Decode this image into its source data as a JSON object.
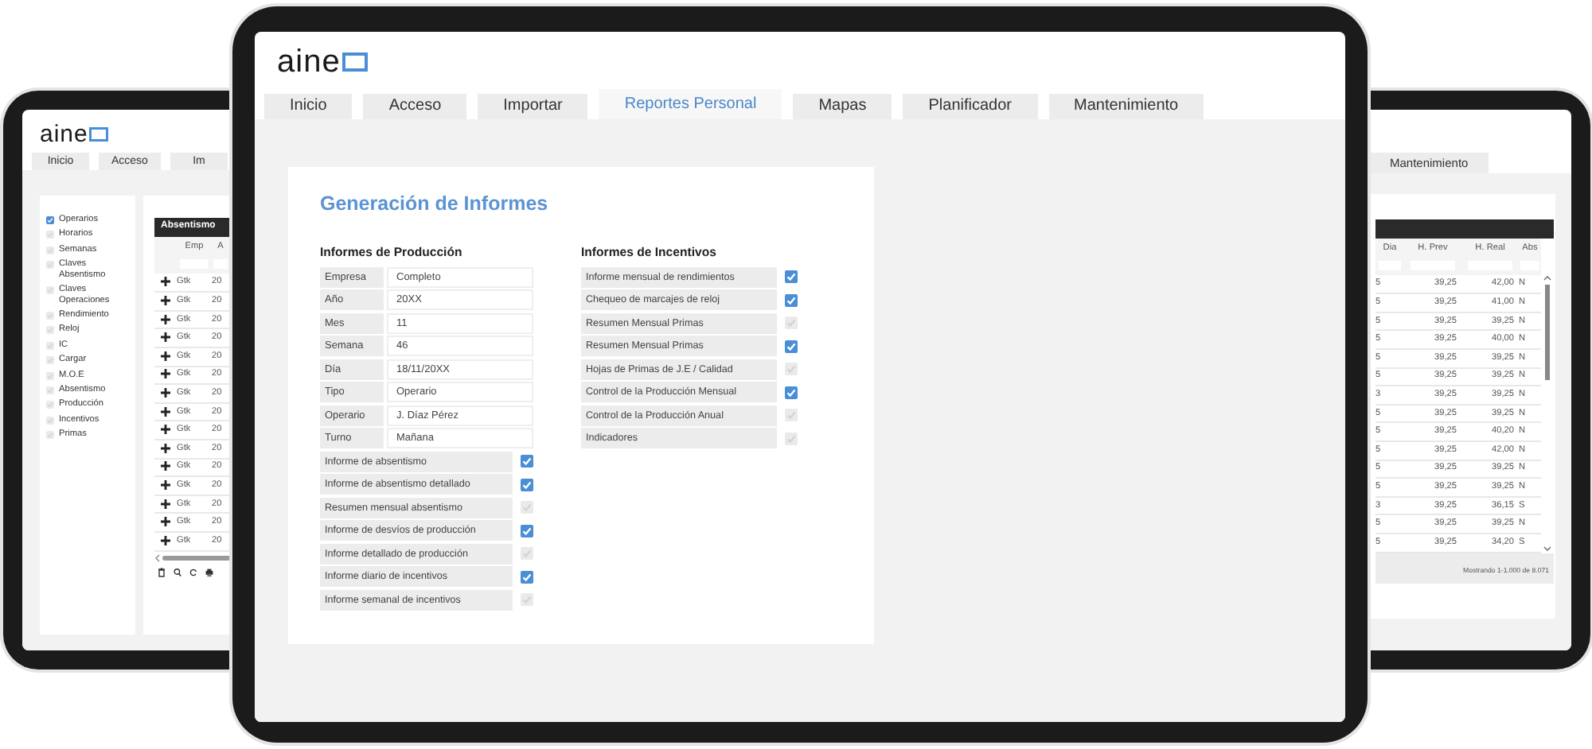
{
  "left_tablet": {
    "logo": "aine",
    "tabs": [
      {
        "label": "Inicio",
        "selected": false
      },
      {
        "label": "Acceso",
        "selected": false
      },
      {
        "label": "Im",
        "selected": false
      }
    ],
    "sidebar": {
      "items": [
        {
          "label": "Operarios",
          "checked": true
        },
        {
          "label": "Horarios",
          "checked": false
        },
        {
          "label": "Semanas",
          "checked": false
        },
        {
          "label": "Claves Absentismo",
          "checked": false
        },
        {
          "label": "Claves Operaciones",
          "checked": false
        },
        {
          "label": "Rendimiento",
          "checked": false
        },
        {
          "label": "Reloj",
          "checked": false
        },
        {
          "label": "IC",
          "checked": false
        },
        {
          "label": "Cargar",
          "checked": false
        },
        {
          "label": "M.O.E",
          "checked": false
        },
        {
          "label": "Absentismo",
          "checked": false
        },
        {
          "label": "Producción",
          "checked": false
        },
        {
          "label": "Incentivos",
          "checked": false
        },
        {
          "label": "Primas",
          "checked": false
        }
      ]
    },
    "table": {
      "title": "Absentismo",
      "columns": [
        "Emp",
        "A"
      ],
      "rows": [
        [
          "Gtk",
          "20"
        ],
        [
          "Gtk",
          "20"
        ],
        [
          "Gtk",
          "20"
        ],
        [
          "Gtk",
          "20"
        ],
        [
          "Gtk",
          "20"
        ],
        [
          "Gtk",
          "20"
        ],
        [
          "Gtk",
          "20"
        ],
        [
          "Gtk",
          "20"
        ],
        [
          "Gtk",
          "20"
        ],
        [
          "Gtk",
          "20"
        ],
        [
          "Gtk",
          "20"
        ],
        [
          "Gtk",
          "20"
        ],
        [
          "Gtk",
          "20"
        ],
        [
          "Gtk",
          "20"
        ],
        [
          "Gtk",
          "20"
        ]
      ]
    }
  },
  "main_tablet": {
    "logo": "aine",
    "tabs": [
      {
        "label": "Inicio",
        "selected": false
      },
      {
        "label": "Acceso",
        "selected": false
      },
      {
        "label": "Importar",
        "selected": false
      },
      {
        "label": "Reportes Personal",
        "selected": true
      },
      {
        "label": "Mapas",
        "selected": false
      },
      {
        "label": "Planificador",
        "selected": false
      },
      {
        "label": "Mantenimiento",
        "selected": false
      }
    ],
    "panel": {
      "title": "Generación de Informes",
      "production": {
        "heading": "Informes de Producción",
        "fields": [
          {
            "label": "Empresa",
            "value": "Completo"
          },
          {
            "label": "Año",
            "value": "20XX"
          },
          {
            "label": "Mes",
            "value": "11"
          },
          {
            "label": "Semana",
            "value": "46"
          },
          {
            "label": "Día",
            "value": "18/11/20XX"
          },
          {
            "label": "Tipo",
            "value": "Operario"
          },
          {
            "label": "Operario",
            "value": "J. Díaz Pérez"
          },
          {
            "label": "Turno",
            "value": "Mañana"
          }
        ],
        "reports": [
          {
            "label": "Informe de absentismo",
            "checked": true
          },
          {
            "label": "Informe de absentismo detallado",
            "checked": true
          },
          {
            "label": "Resumen mensual absentismo",
            "checked": false
          },
          {
            "label": "Informe de desvíos de producción",
            "checked": true
          },
          {
            "label": "Informe detallado de producción",
            "checked": false
          },
          {
            "label": "Informe diario de incentivos",
            "checked": true
          },
          {
            "label": "Informe semanal de incentivos",
            "checked": false
          }
        ]
      },
      "incentives": {
        "heading": "Informes de Incentivos",
        "reports": [
          {
            "label": "Informe mensual de rendimientos",
            "checked": true
          },
          {
            "label": "Chequeo de marcajes de reloj",
            "checked": true
          },
          {
            "label": "Resumen Mensual Primas",
            "checked": false
          },
          {
            "label": "Resumen Mensual Primas",
            "checked": true
          },
          {
            "label": "Hojas de Primas de J.E / Calidad",
            "checked": false
          },
          {
            "label": "Control de la Producción Mensual",
            "checked": true
          },
          {
            "label": "Control de la Producción Anual",
            "checked": false
          },
          {
            "label": "Indicadores",
            "checked": false
          }
        ]
      }
    }
  },
  "right_tablet": {
    "tabs": [
      {
        "label": "Mantenimiento",
        "selected": false
      }
    ],
    "table": {
      "columns": [
        "Dia",
        "H. Prev",
        "H. Real",
        "Abs"
      ],
      "rows": [
        [
          "5",
          "39,25",
          "42,00",
          "N"
        ],
        [
          "5",
          "39,25",
          "41,00",
          "N"
        ],
        [
          "5",
          "39,25",
          "39,25",
          "N"
        ],
        [
          "5",
          "39,25",
          "40,00",
          "N"
        ],
        [
          "5",
          "39,25",
          "39,25",
          "N"
        ],
        [
          "5",
          "39,25",
          "39,25",
          "N"
        ],
        [
          "3",
          "39,25",
          "39,25",
          "N"
        ],
        [
          "5",
          "39,25",
          "39,25",
          "N"
        ],
        [
          "5",
          "39,25",
          "40,20",
          "N"
        ],
        [
          "5",
          "39,25",
          "42,00",
          "N"
        ],
        [
          "5",
          "39,25",
          "39,25",
          "N"
        ],
        [
          "5",
          "39,25",
          "39,25",
          "N"
        ],
        [
          "3",
          "39,25",
          "36,15",
          "S"
        ],
        [
          "5",
          "39,25",
          "39,25",
          "N"
        ],
        [
          "5",
          "39,25",
          "34,20",
          "S"
        ]
      ],
      "footer": "Mostrando 1-1.000 de 8.071"
    }
  }
}
